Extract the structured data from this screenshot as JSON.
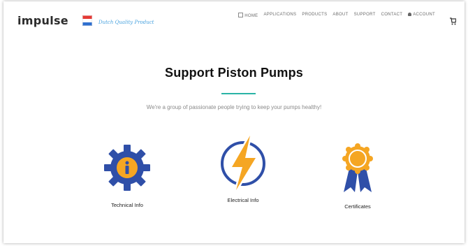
{
  "header": {
    "logo_text": "impulse",
    "tagline": "Dutch Quality Product",
    "nav": [
      "HOME",
      "APPLICATIONS",
      "PRODUCTS",
      "ABOUT",
      "SUPPORT",
      "CONTACT",
      "ACCOUNT"
    ]
  },
  "hero": {
    "title": "Support Piston Pumps",
    "subtitle": "We're a group of passionate people trying to keep your pumps healthy!"
  },
  "features": [
    {
      "label": "Technical Info",
      "icon": "gear-info-icon"
    },
    {
      "label": "Electrical Info",
      "icon": "lightning-bolt-icon"
    },
    {
      "label": "Certificates",
      "icon": "award-ribbon-icon"
    }
  ],
  "colors": {
    "accent": "#2ab4a6",
    "icon_blue": "#2f4fa8",
    "icon_orange": "#f5a623",
    "tagline_blue": "#4aa3df"
  }
}
